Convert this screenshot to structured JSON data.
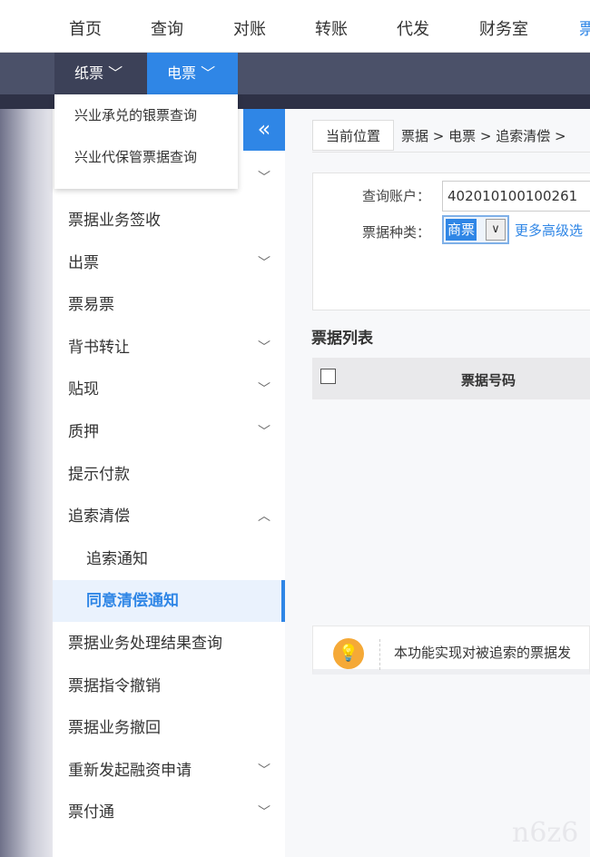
{
  "topnav": [
    "首页",
    "查询",
    "对账",
    "转账",
    "代发",
    "财务室",
    "票"
  ],
  "subnav": {
    "paper": "纸票",
    "electronic": "电票"
  },
  "dropdown": [
    "兴业承兑的银票查询",
    "兴业代保管票据查询"
  ],
  "sidebar": {
    "collapse": "«",
    "items": [
      {
        "label": "票据业务签收"
      },
      {
        "label": "出票",
        "chev": "﹀"
      },
      {
        "label": "票易票"
      },
      {
        "label": "背书转让",
        "chev": "﹀"
      },
      {
        "label": "贴现",
        "chev": "﹀"
      },
      {
        "label": "质押",
        "chev": "﹀"
      },
      {
        "label": "提示付款"
      },
      {
        "label": "追索清偿",
        "chev": "︿"
      },
      {
        "label": "追索通知"
      },
      {
        "label": "同意清偿通知"
      },
      {
        "label": "票据业务处理结果查询"
      },
      {
        "label": "票据指令撤销"
      },
      {
        "label": "票据业务撤回"
      },
      {
        "label": "重新发起融资申请",
        "chev": "﹀"
      },
      {
        "label": "票付通",
        "chev": "﹀"
      }
    ]
  },
  "breadcrumb": {
    "current": "当前位置",
    "path": "票据 > 电票 > 追索清偿 >"
  },
  "form": {
    "account_label": "查询账户：",
    "account_value": "402010100100261",
    "type_label": "票据种类：",
    "type_value": "商票",
    "more": "更多高级选"
  },
  "list": {
    "title": "票据列表",
    "col": "票据号码"
  },
  "tip": "本功能实现对被追索的票据发",
  "watermark": "n6z6"
}
